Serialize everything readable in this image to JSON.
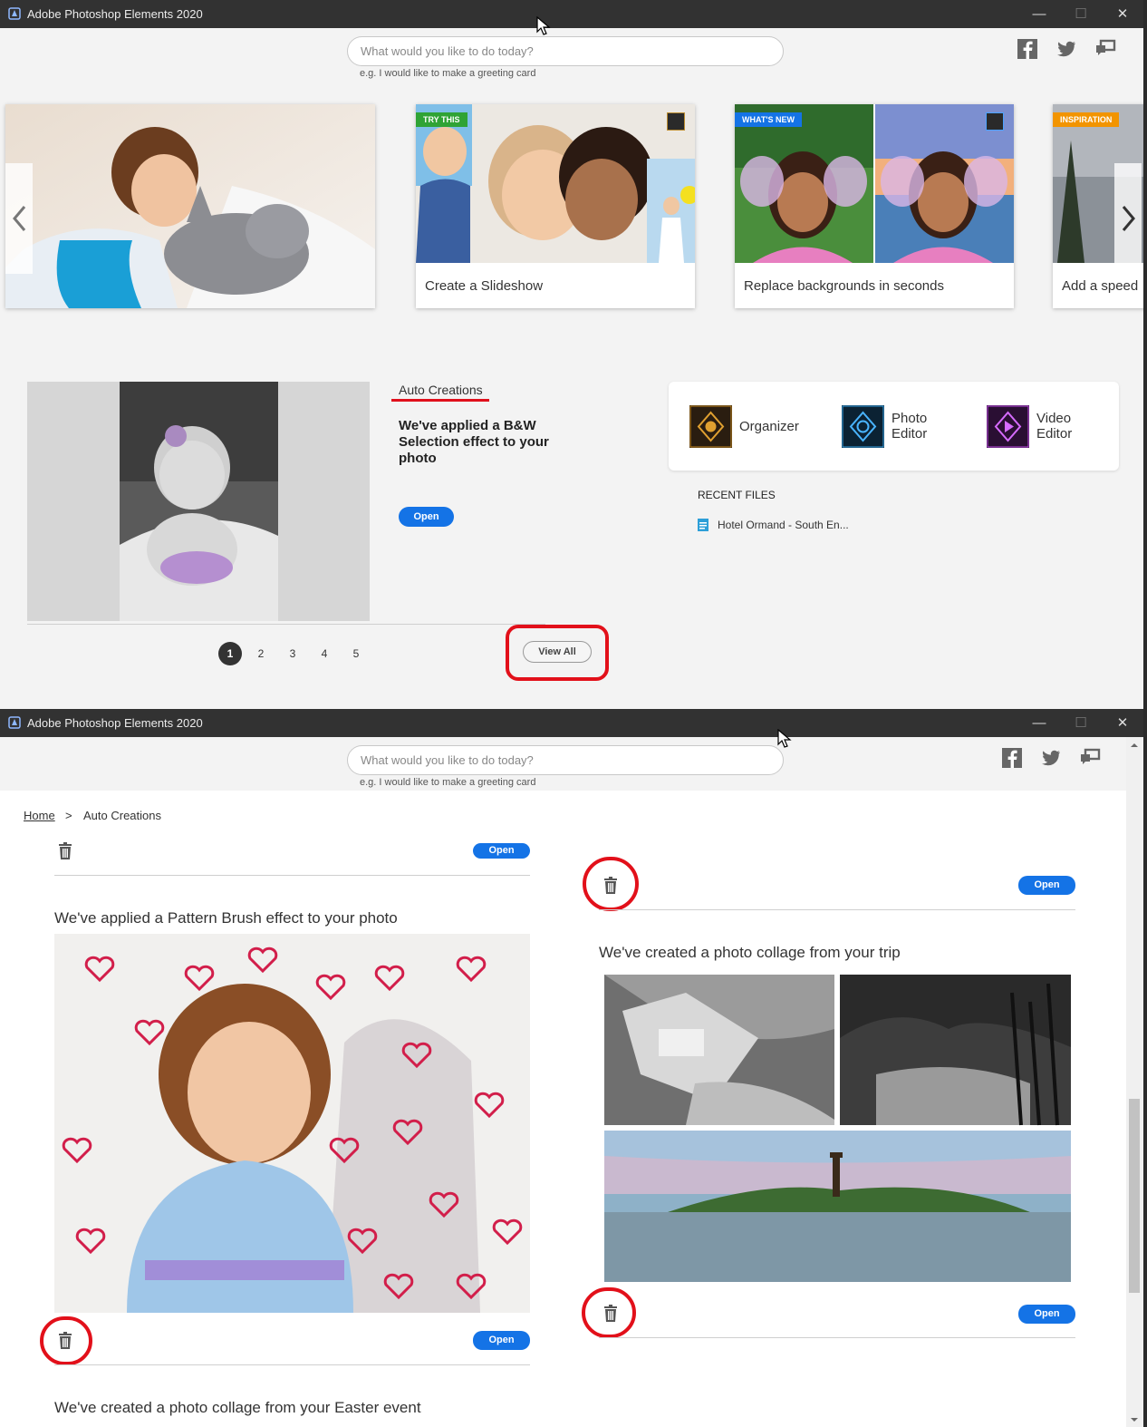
{
  "window": {
    "title": "Adobe Photoshop Elements 2020",
    "controls": {
      "minimize": "—",
      "maximize": "☐",
      "close": "✕"
    }
  },
  "search": {
    "placeholder": "What would you like to do today?",
    "hint": "e.g. I would like to make a greeting card"
  },
  "social": [
    "facebook-icon",
    "twitter-icon",
    "feedback-icon"
  ],
  "carousel": {
    "cards": [
      {
        "badge": "",
        "caption": ""
      },
      {
        "badge": "TRY THIS",
        "badge_color": "#2fa335",
        "caption": "Create a Slideshow"
      },
      {
        "badge": "WHAT'S NEW",
        "badge_color": "#1473e6",
        "caption": "Replace backgrounds in seconds"
      },
      {
        "badge": "INSPIRATION",
        "badge_color": "#f29400",
        "caption": "Add a speed"
      }
    ]
  },
  "auto_creations": {
    "section_title": "Auto Creations",
    "description": "We've applied a B&W Selection effect to your photo",
    "open_label": "Open",
    "pages": [
      "1",
      "2",
      "3",
      "4",
      "5"
    ],
    "active_page": "1",
    "view_all_label": "View All"
  },
  "apps": [
    {
      "name": "Organizer",
      "icon": "organizer-icon"
    },
    {
      "name": "Photo Editor",
      "line1": "Photo",
      "line2": "Editor",
      "icon": "photo-editor-icon"
    },
    {
      "name": "Video Editor",
      "line1": "Video",
      "line2": "Editor",
      "icon": "video-editor-icon"
    }
  ],
  "recent_files": {
    "title": "RECENT FILES",
    "items": [
      "Hotel Ormand - South En..."
    ]
  },
  "view_all_page": {
    "breadcrumb": {
      "home": "Home",
      "separator": ">",
      "current": "Auto Creations"
    },
    "open_label": "Open",
    "left_items": [
      {
        "title": "We've applied a Pattern Brush effect to your photo"
      },
      {
        "title": "We've created a photo collage from your Easter event"
      }
    ],
    "right_items": [
      {
        "title": "We've created a photo collage from your trip"
      }
    ]
  },
  "colors": {
    "accent_blue": "#1473e6",
    "annotation_red": "#e2101a",
    "titlebar": "#323232"
  }
}
